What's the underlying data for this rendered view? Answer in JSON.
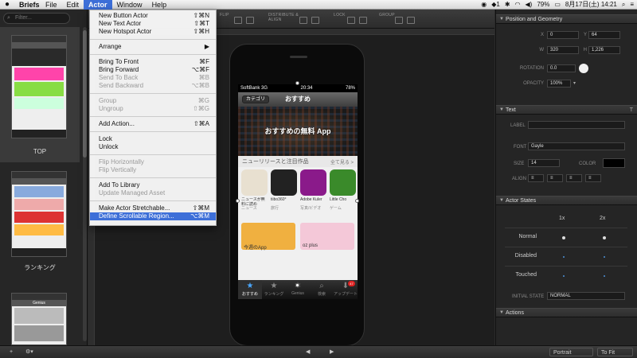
{
  "menubar": {
    "apple": "",
    "app": "Briefs",
    "items": [
      "File",
      "Edit",
      "Actor",
      "Window",
      "Help"
    ],
    "right": {
      "battery": "79%",
      "datetime": "8月17日(土)  14:21"
    }
  },
  "sidebar": {
    "filter_placeholder": "Filter...",
    "thumbs": [
      {
        "label": "TOP"
      },
      {
        "label": "ランキング"
      },
      {
        "label": "Genius"
      }
    ]
  },
  "toolbar": {
    "labels": [
      "FLIP",
      "DISTRIBUTE & ALIGN",
      "LOCK",
      "GROUP"
    ]
  },
  "phone": {
    "status": {
      "carrier": "SoftBank  3G",
      "time": "20:34",
      "battery": "78%"
    },
    "nav": {
      "back": "カテゴリ",
      "title": "おすすめ"
    },
    "banner": "おすすめの無料 App",
    "section": {
      "title": "ニューリリースと注目作品",
      "more": "全て見る >"
    },
    "apps": [
      {
        "name": "ニュースが無料に読める・・・",
        "cat": "ニュース",
        "color": "#e8e0d0"
      },
      {
        "name": "tiibo360°",
        "cat": "旅行",
        "color": "#222"
      },
      {
        "name": "Adobe Kuler",
        "cat": "写真/ビデオ",
        "color": "#8a1a8a"
      },
      {
        "name": "Little Cho",
        "cat": "ゲーム",
        "color": "#3a8a2a"
      }
    ],
    "cards": [
      {
        "text": "今週のApp",
        "color": "#f0b040"
      },
      {
        "text": "oz plus",
        "color": "#f4c8d8"
      }
    ],
    "tabs": [
      {
        "label": "おすすめ",
        "glyph": "★",
        "active": true
      },
      {
        "label": "ランキング",
        "glyph": "★",
        "active": false
      },
      {
        "label": "Genius",
        "glyph": "⚛",
        "active": false
      },
      {
        "label": "検索",
        "glyph": "⌕",
        "active": false
      },
      {
        "label": "アップデート",
        "glyph": "⬇",
        "active": false,
        "badge": "47"
      }
    ]
  },
  "actor_menu": [
    {
      "label": "New Button Actor",
      "sc": "⇧⌘N"
    },
    {
      "label": "New Text Actor",
      "sc": "⇧⌘T"
    },
    {
      "label": "New Hotspot Actor",
      "sc": "⇧⌘H"
    },
    {
      "sep": true
    },
    {
      "label": "Arrange",
      "sc": "▶"
    },
    {
      "sep": true
    },
    {
      "label": "Bring To Front",
      "sc": "⌘F"
    },
    {
      "label": "Bring Forward",
      "sc": "⌥⌘F"
    },
    {
      "label": "Send To Back",
      "sc": "⌘B",
      "disabled": true
    },
    {
      "label": "Send Backward",
      "sc": "⌥⌘B",
      "disabled": true
    },
    {
      "sep": true
    },
    {
      "label": "Group",
      "sc": "⌘G",
      "disabled": true
    },
    {
      "label": "Ungroup",
      "sc": "⇧⌘G",
      "disabled": true
    },
    {
      "sep": true
    },
    {
      "label": "Add Action...",
      "sc": "⇧⌘A"
    },
    {
      "sep": true
    },
    {
      "label": "Lock",
      "sc": ""
    },
    {
      "label": "Unlock",
      "sc": ""
    },
    {
      "sep": true
    },
    {
      "label": "Flip Horizontally",
      "sc": "",
      "disabled": true
    },
    {
      "label": "Flip Vertically",
      "sc": "",
      "disabled": true
    },
    {
      "sep": true
    },
    {
      "label": "Add To Library",
      "sc": ""
    },
    {
      "label": "Update Managed Asset",
      "sc": "",
      "disabled": true
    },
    {
      "sep": true
    },
    {
      "label": "Make Actor Stretchable...",
      "sc": "⇧⌘M"
    },
    {
      "label": "Define Scrollable Region...",
      "sc": "⌥⌘M",
      "highlight": true
    }
  ],
  "inspector": {
    "geometry": {
      "title": "Position and Geometry",
      "x_label": "X",
      "x": "0",
      "y_label": "Y",
      "y": "64",
      "w_label": "W",
      "w": "320",
      "h_label": "H",
      "h": "1,226",
      "rotation_label": "ROTATION",
      "rotation": "0.0",
      "opacity_label": "OPACITY",
      "opacity": "100%"
    },
    "text": {
      "title": "Text",
      "label_label": "LABEL",
      "font_label": "FONT",
      "font": "Gayle",
      "size_label": "SIZE",
      "size": "14",
      "color_label": "COLOR",
      "align_label": "ALIGN"
    },
    "states": {
      "title": "Actor States",
      "col1": "1x",
      "col2": "2x",
      "rows": [
        "Normal",
        "Disabled",
        "Touched"
      ],
      "initial_label": "INITIAL STATE",
      "initial": "NORMAL"
    },
    "actions": {
      "title": "Actions"
    }
  },
  "bottombar": {
    "add": "+",
    "gear": "⚙▾",
    "prev": "◀",
    "next": "▶",
    "orientation": "Portrait",
    "zoom": "To Fit"
  }
}
